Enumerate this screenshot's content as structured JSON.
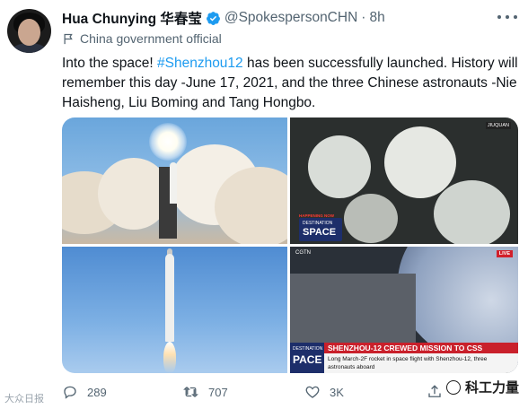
{
  "tweet": {
    "author_name": "Hua Chunying 华春莹",
    "handle": "@SpokespersonCHN",
    "separator": "·",
    "time": "8h",
    "label": "China government official",
    "text_before": "Into the space! ",
    "hashtag": "#Shenzhou12",
    "text_after": " has been successfully launched. History will remember this day -June 17, 2021, and the three Chinese astronauts -Nie Haisheng, Liu Boming and Tang Hongbo."
  },
  "media": {
    "crew_photo": {
      "jiuquan": "JIUQUAN",
      "happening": "HAPPENING NOW",
      "destination": "DESTINATION",
      "space": "SPACE"
    },
    "station_photo": {
      "stn": "CGTN",
      "live": "LIVE",
      "destination": "DESTINATION",
      "space": "PACE",
      "headline": "SHENZHOU-12 CREWED MISSION TO CSS",
      "subline": "Long March-2F rocket in space flight with Shenzhou-12, three astronauts aboard"
    }
  },
  "actions": {
    "reply_count": "289",
    "retweet_count": "707",
    "like_count": "3K"
  },
  "watermarks": {
    "left": "大众日报",
    "right": "科工力量"
  },
  "colors": {
    "accent": "#1d9bf0",
    "muted": "#536471",
    "text": "#0f1419"
  }
}
